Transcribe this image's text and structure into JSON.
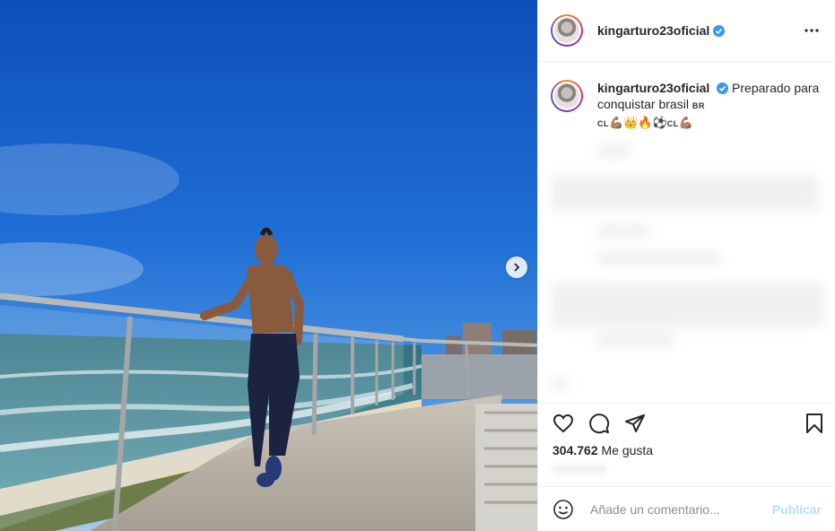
{
  "post": {
    "username": "kingarturo23oficial",
    "caption_text": "Preparado para conquistar brasil",
    "flag_br": "BR",
    "emoji_line": [
      "CL",
      "💪🏽",
      "👑",
      "🔥",
      "⚽",
      "CL",
      "💪🏽"
    ],
    "likes_count": "304.762",
    "likes_label": "Me gusta"
  },
  "comment_box": {
    "placeholder": "Añade un comentario...",
    "post_label": "Publicar"
  },
  "icons": {
    "verified": "verified-badge-icon",
    "more": "more-options-icon",
    "like": "heart-icon",
    "comment": "comment-icon",
    "share": "share-icon",
    "save": "bookmark-icon",
    "emoji": "emoji-icon",
    "next": "chevron-right-icon"
  },
  "colors": {
    "verified": "#3897f0",
    "post_button": "#b2dffc",
    "text": "#262626",
    "sky": "#1565c8"
  }
}
